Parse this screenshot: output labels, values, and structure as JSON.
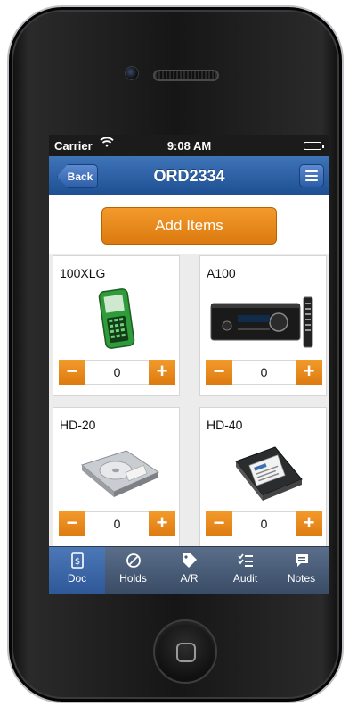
{
  "status_bar": {
    "carrier": "Carrier",
    "time": "9:08 AM"
  },
  "nav": {
    "back_label": "Back",
    "title": "ORD2334"
  },
  "actions": {
    "add_items_label": "Add Items"
  },
  "products": [
    {
      "name": "100XLG",
      "quantity": "0",
      "image": "green-phone"
    },
    {
      "name": "A100",
      "quantity": "0",
      "image": "av-receiver"
    },
    {
      "name": "HD-20",
      "quantity": "0",
      "image": "hard-drive"
    },
    {
      "name": "HD-40",
      "quantity": "0",
      "image": "hard-drive"
    }
  ],
  "stepper": {
    "minus_label": "−",
    "plus_label": "+"
  },
  "tabs": [
    {
      "label": "Doc",
      "icon": "document-icon",
      "active": true
    },
    {
      "label": "Holds",
      "icon": "prohibited-icon",
      "active": false
    },
    {
      "label": "A/R",
      "icon": "tag-icon",
      "active": false
    },
    {
      "label": "Audit",
      "icon": "checklist-icon",
      "active": false
    },
    {
      "label": "Notes",
      "icon": "speech-bubble-icon",
      "active": false
    }
  ],
  "colors": {
    "accent_orange": "#f39a2b",
    "nav_blue": "#2c5ea8",
    "tab_bar": "#4a5d78"
  }
}
